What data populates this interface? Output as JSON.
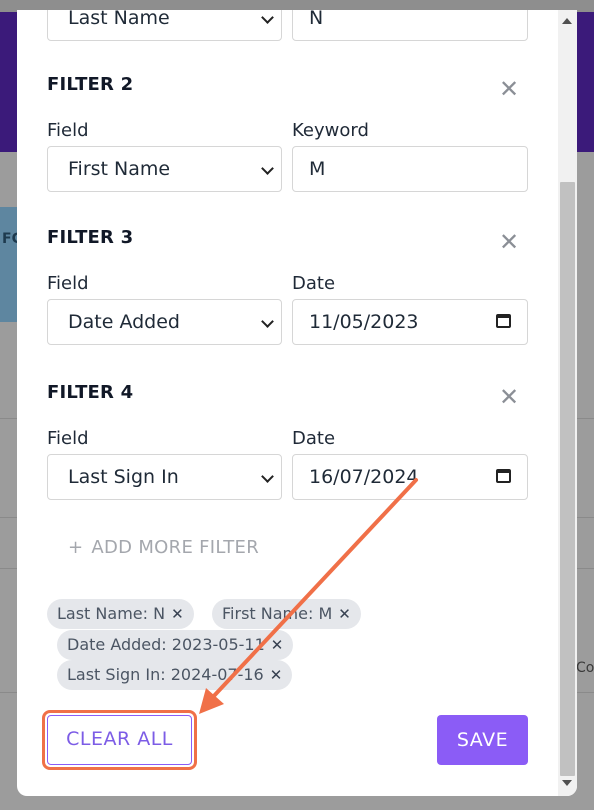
{
  "background": {
    "band_text": "FC",
    "right_text": "Co"
  },
  "top_row": {
    "field_value": "Last Name",
    "keyword_value": "N"
  },
  "filters": [
    {
      "title": "FILTER 2",
      "field_label": "Field",
      "value_label": "Keyword",
      "field_value": "First Name",
      "value": "M"
    },
    {
      "title": "FILTER 3",
      "field_label": "Field",
      "value_label": "Date",
      "field_value": "Date Added",
      "value": "11/05/2023"
    },
    {
      "title": "FILTER 4",
      "field_label": "Field",
      "value_label": "Date",
      "field_value": "Last Sign In",
      "value": "16/07/2024"
    }
  ],
  "add_filter": {
    "icon": "+",
    "label": "ADD MORE FILTER"
  },
  "chips": [
    {
      "label": "Last Name: N",
      "remove": "✕"
    },
    {
      "label": "First Name: M",
      "remove": "✕"
    },
    {
      "label": "Date Added: 2023-05-11",
      "remove": "✕"
    },
    {
      "label": "Last Sign In: 2024-07-16",
      "remove": "✕"
    }
  ],
  "close_icon": "✕",
  "buttons": {
    "clear_all": "CLEAR ALL",
    "save": "SAVE"
  },
  "colors": {
    "accent": "#8b5cf6",
    "highlight": "#f07048",
    "header": "#3b1a7a"
  }
}
